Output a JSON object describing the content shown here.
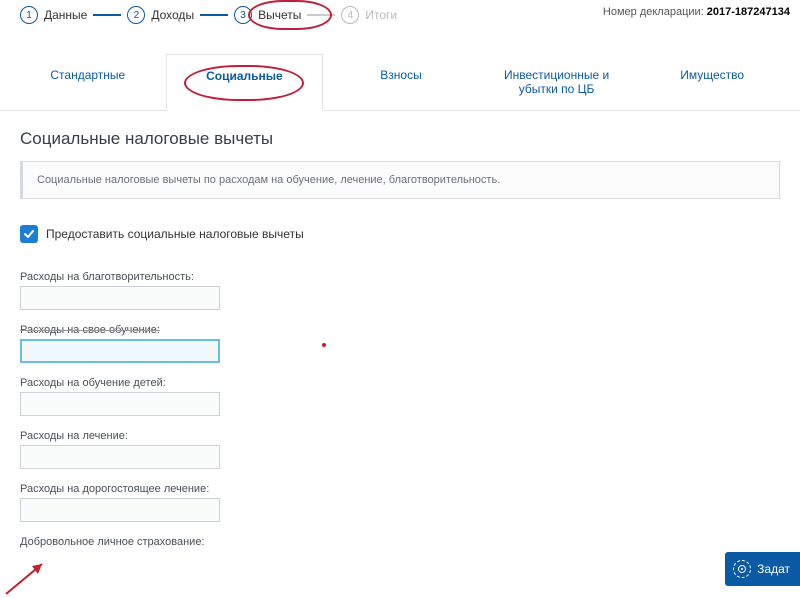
{
  "stepper": {
    "steps": [
      {
        "num": "1",
        "label": "Данные"
      },
      {
        "num": "2",
        "label": "Доходы"
      },
      {
        "num": "3",
        "label": "Вычеты"
      },
      {
        "num": "4",
        "label": "Итоги"
      }
    ]
  },
  "declaration": {
    "label": "Номер декларации:",
    "value": "2017-187247134"
  },
  "tabs": {
    "items": [
      {
        "label": "Стандартные"
      },
      {
        "label": "Социальные"
      },
      {
        "label": "Взносы"
      },
      {
        "label": "Инвестиционные и убытки по ЦБ"
      },
      {
        "label": "Имущество"
      }
    ]
  },
  "section": {
    "title": "Социальные налоговые вычеты",
    "info": "Социальные налоговые вычеты по расходам на обучение, лечение, благотворительность."
  },
  "checkbox": {
    "label": "Предоставить социальные налоговые вычеты",
    "checked": true
  },
  "fields": {
    "f1": {
      "label": "Расходы на благотворительность:"
    },
    "f2": {
      "label": "Расходы на свое обучение:"
    },
    "f3": {
      "label": "Расходы на обучение детей:"
    },
    "f4": {
      "label": "Расходы на лечение:"
    },
    "f5": {
      "label": "Расходы на дорогостоящее лечение:"
    },
    "f6": {
      "label": "Добровольное личное страхование:"
    }
  },
  "help": {
    "label": "Задат"
  }
}
